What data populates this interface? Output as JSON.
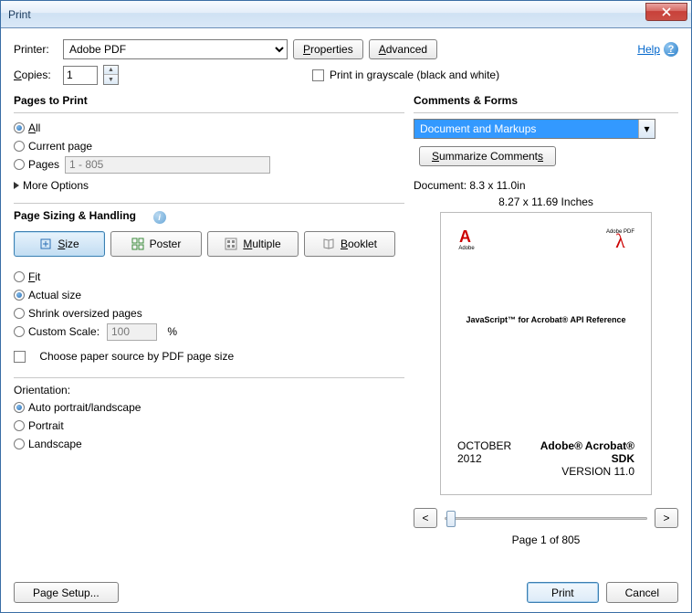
{
  "window": {
    "title": "Print"
  },
  "top": {
    "printer_label": "Printer:",
    "printer_value": "Adobe PDF",
    "properties_btn_u": "P",
    "properties_btn_rest": "roperties",
    "advanced_btn_u": "A",
    "advanced_btn_rest": "dvanced",
    "help_u": "H",
    "help_rest": "elp",
    "copies_label_u": "C",
    "copies_label_rest": "opies:",
    "copies_value": "1",
    "grayscale_label": "Print in grayscale (black and white)"
  },
  "pages": {
    "title": "Pages to Print",
    "all_u": "A",
    "all_rest": "ll",
    "current": "Current page",
    "pages_label": "Pages",
    "pages_value": "1 - 805",
    "more": "More Options"
  },
  "sizing": {
    "title": "Page Sizing & Handling",
    "size_u": "S",
    "size_rest": "ize",
    "poster_label": "Poster",
    "multiple_u": "M",
    "multiple_rest": "ultiple",
    "booklet_u": "B",
    "booklet_rest": "ooklet",
    "fit_u": "F",
    "fit_rest": "it",
    "actual": "Actual size",
    "shrink": "Shrink oversized pages",
    "custom": "Custom Scale:",
    "scale_value": "100",
    "percent": "%",
    "paper_source": "Choose paper source by PDF page size"
  },
  "orientation": {
    "title": "Orientation:",
    "auto": "Auto portrait/landscape",
    "portrait": "Portrait",
    "landscape": "Landscape"
  },
  "comments": {
    "title": "Comments & Forms",
    "selected": "Document and Markups",
    "summarize_u": "S",
    "summarize_rest": "ummarize Comment",
    "summarize_u2": "s"
  },
  "preview": {
    "doc_dims": "Document: 8.3 x 11.0in",
    "inches": "8.27 x 11.69 Inches",
    "adobe": "Adobe",
    "pdf_text": "Adobe PDF",
    "title": "JavaScript™ for Acrobat® API Reference",
    "footer_left": "OCTOBER 2012",
    "footer_right1": "Adobe® Acrobat® SDK",
    "footer_right2": "VERSION 11.0",
    "page_of": "Page 1 of 805",
    "prev": "<",
    "next": ">"
  },
  "footer": {
    "page_setup": "Page Setup...",
    "print": "Print",
    "cancel": "Cancel"
  }
}
